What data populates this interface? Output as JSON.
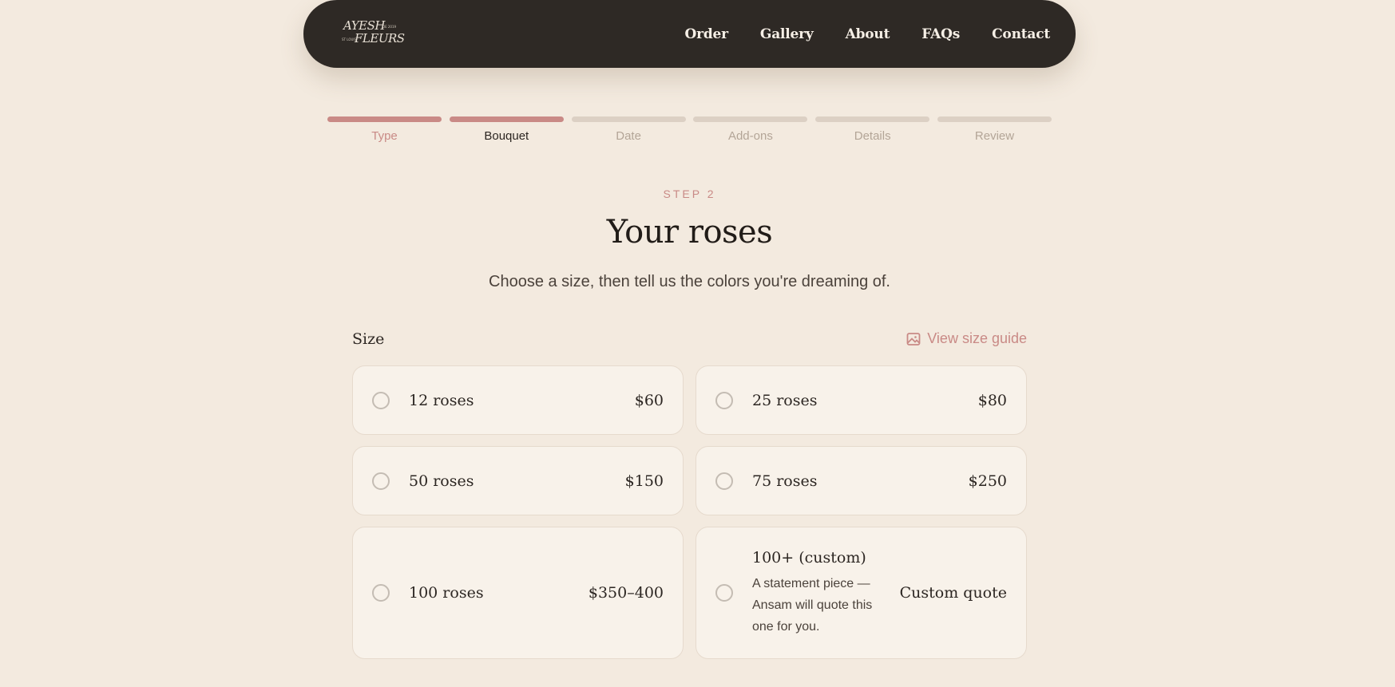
{
  "brand": {
    "logo_line1": "AYESH",
    "logo_line2": "FLEURS",
    "logo_small1": "DE 2019",
    "logo_small2": "ST LOUIS"
  },
  "nav": {
    "items": [
      {
        "label": "Order"
      },
      {
        "label": "Gallery"
      },
      {
        "label": "About"
      },
      {
        "label": "FAQs"
      },
      {
        "label": "Contact"
      }
    ]
  },
  "steps": [
    {
      "label": "Type",
      "state": "done"
    },
    {
      "label": "Bouquet",
      "state": "current"
    },
    {
      "label": "Date",
      "state": "upcoming"
    },
    {
      "label": "Add-ons",
      "state": "upcoming"
    },
    {
      "label": "Details",
      "state": "upcoming"
    },
    {
      "label": "Review",
      "state": "upcoming"
    }
  ],
  "header": {
    "eyebrow": "STEP 2",
    "title": "Your roses",
    "subtitle": "Choose a size, then tell us the colors you're dreaming of."
  },
  "size": {
    "label": "Size",
    "guide_link": "View size guide",
    "options": [
      {
        "name": "12 roses",
        "price": "$60"
      },
      {
        "name": "25 roses",
        "price": "$80"
      },
      {
        "name": "50 roses",
        "price": "$150"
      },
      {
        "name": "75 roses",
        "price": "$250"
      },
      {
        "name": "100 roses",
        "price": "$350–400"
      },
      {
        "name": "100+ (custom)",
        "description": "A statement piece — Ansam will quote this one for you.",
        "price": "Custom quote"
      }
    ]
  },
  "colors": {
    "background": "#f3eadf",
    "nav_background": "#2e2925",
    "accent": "#c98a86",
    "card_background": "#f8f2ea"
  }
}
